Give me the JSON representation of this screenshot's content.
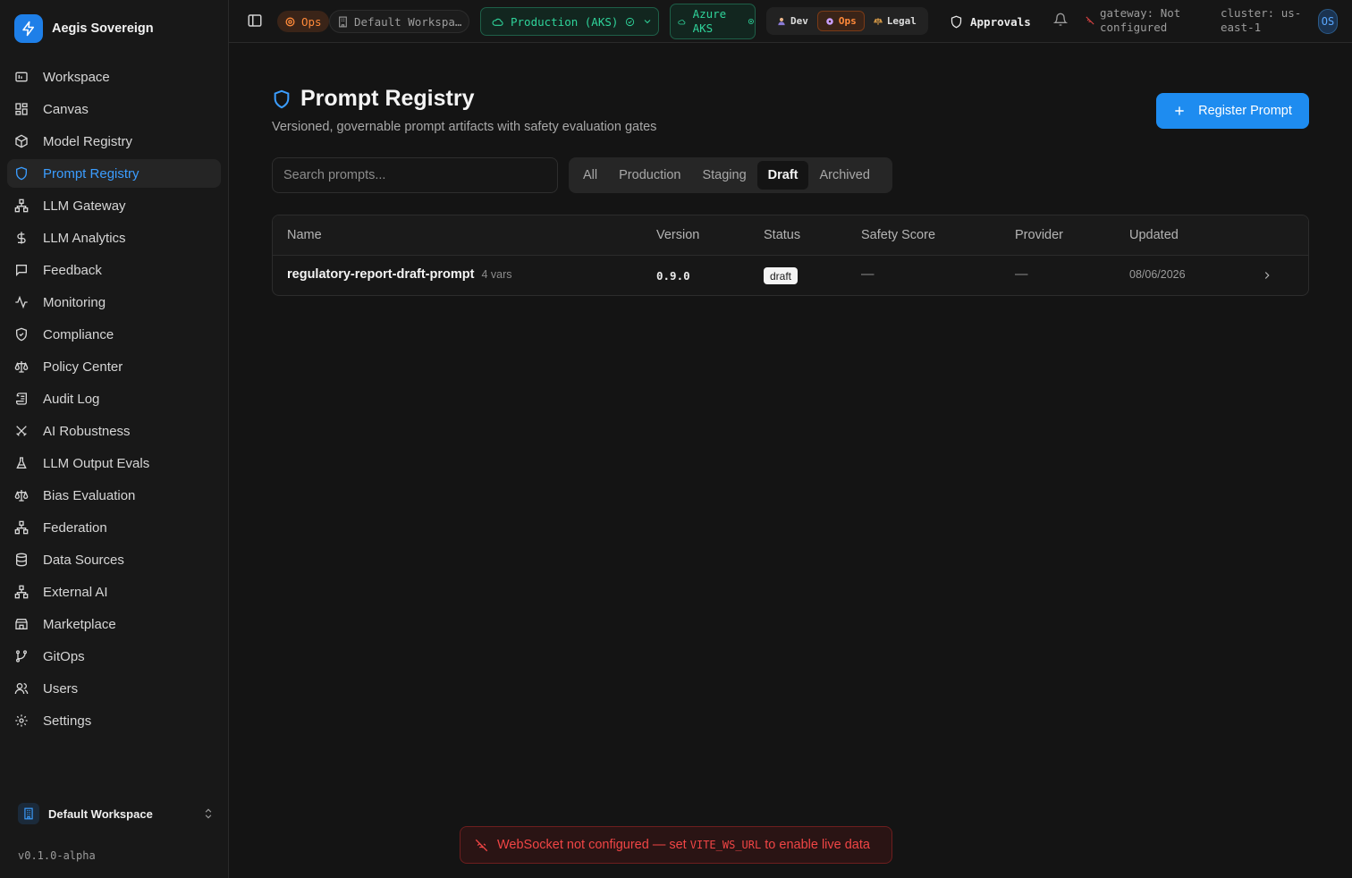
{
  "brand": {
    "name": "Aegis Sovereign"
  },
  "sidebar": {
    "items": [
      {
        "label": "Workspace",
        "icon": "workspace-icon"
      },
      {
        "label": "Canvas",
        "icon": "grid-icon"
      },
      {
        "label": "Model Registry",
        "icon": "cube-icon"
      },
      {
        "label": "Prompt Registry",
        "icon": "shield-icon",
        "active": true
      },
      {
        "label": "LLM Gateway",
        "icon": "network-icon"
      },
      {
        "label": "LLM Analytics",
        "icon": "dollar-icon"
      },
      {
        "label": "Feedback",
        "icon": "message-icon"
      },
      {
        "label": "Monitoring",
        "icon": "activity-icon"
      },
      {
        "label": "Compliance",
        "icon": "shield-check-icon"
      },
      {
        "label": "Policy Center",
        "icon": "scale-icon"
      },
      {
        "label": "Audit Log",
        "icon": "scroll-icon"
      },
      {
        "label": "AI Robustness",
        "icon": "swords-icon"
      },
      {
        "label": "LLM Output Evals",
        "icon": "flask-icon"
      },
      {
        "label": "Bias Evaluation",
        "icon": "scale-icon"
      },
      {
        "label": "Federation",
        "icon": "network-icon"
      },
      {
        "label": "Data Sources",
        "icon": "database-icon"
      },
      {
        "label": "External AI",
        "icon": "network-icon"
      },
      {
        "label": "Marketplace",
        "icon": "store-icon"
      },
      {
        "label": "GitOps",
        "icon": "git-branch-icon"
      },
      {
        "label": "Users",
        "icon": "users-icon"
      },
      {
        "label": "Settings",
        "icon": "gear-icon"
      }
    ],
    "workspace": "Default Workspace",
    "version": "v0.1.0-alpha"
  },
  "topbar": {
    "ops_badge": "Ops",
    "workspace": "Default Workspa…",
    "environment": "Production (AKS)",
    "cluster_type_line1": "Azure",
    "cluster_type_line2": "AKS",
    "roles": [
      "Dev",
      "Ops",
      "Legal"
    ],
    "active_role": "Ops",
    "approvals": "Approvals",
    "gateway_line1": "gateway: Not",
    "gateway_line2": "configured",
    "cluster_line1": "cluster: us-",
    "cluster_line2": "east-1",
    "avatar_initials": "OS"
  },
  "page": {
    "title": "Prompt Registry",
    "subtitle": "Versioned, governable prompt artifacts with safety evaluation gates",
    "register_button": "Register Prompt",
    "search_placeholder": "Search prompts...",
    "filters": [
      "All",
      "Production",
      "Staging",
      "Draft",
      "Archived"
    ],
    "active_filter": "Draft"
  },
  "table": {
    "columns": [
      "Name",
      "Version",
      "Status",
      "Safety Score",
      "Provider",
      "Updated"
    ],
    "rows": [
      {
        "name": "regulatory-report-draft-prompt",
        "vars": "4 vars",
        "version": "0.9.0",
        "status": "draft",
        "safety_score": "—",
        "provider": "—",
        "updated": "08/06/2026"
      }
    ]
  },
  "toast": {
    "text_before": "WebSocket not configured — set ",
    "code": "VITE_WS_URL",
    "text_after": " to enable live data"
  },
  "colors": {
    "accent": "#1e8cf0",
    "active_nav": "#3b9dff",
    "ops_orange": "#ff8a3a",
    "env_green": "#2fd39a",
    "error_red": "#f04545"
  }
}
